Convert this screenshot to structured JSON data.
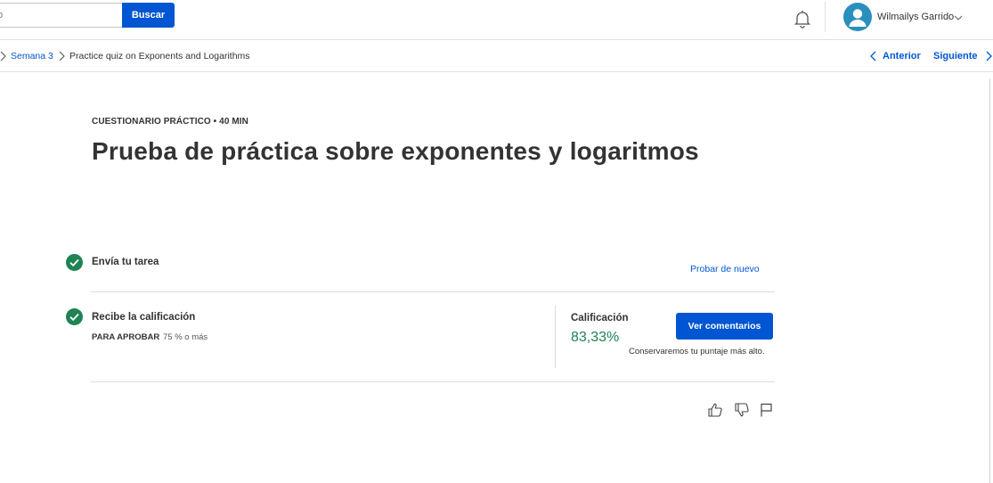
{
  "header": {
    "search_placeholder": "o",
    "search_button": "Buscar",
    "user_name": "Wilmailys Garrido"
  },
  "breadcrumb": {
    "week": "Semana 3",
    "current": "Practice quiz on Exponents and Logarithms"
  },
  "nav": {
    "previous": "Anterior",
    "next": "Siguiente"
  },
  "quiz": {
    "type": "CUESTIONARIO PRÁCTICO",
    "separator": "•",
    "duration": "40 MIN",
    "title": "Prueba de práctica sobre exponentes y logaritmos"
  },
  "steps": {
    "submit_label": "Envía tu tarea",
    "retry_link": "Probar de nuevo",
    "grade_step_label": "Recibe la calificación",
    "pass_label": "PARA APROBAR",
    "pass_value": "75 % o más"
  },
  "grade": {
    "label": "Calificación",
    "value": "83,33%",
    "feedback_button": "Ver comentarios",
    "note": "Conservaremos tu puntaje más alto."
  },
  "colors": {
    "brand_blue": "#0056d2",
    "success_green": "#1f8354",
    "avatar_blue": "#2a8fbd"
  },
  "icons": [
    "bell-icon",
    "user-avatar-icon",
    "chevron-down-icon",
    "chevron-left-icon",
    "chevron-right-icon",
    "check-circle-icon",
    "thumbs-up-icon",
    "thumbs-down-icon",
    "flag-icon"
  ]
}
